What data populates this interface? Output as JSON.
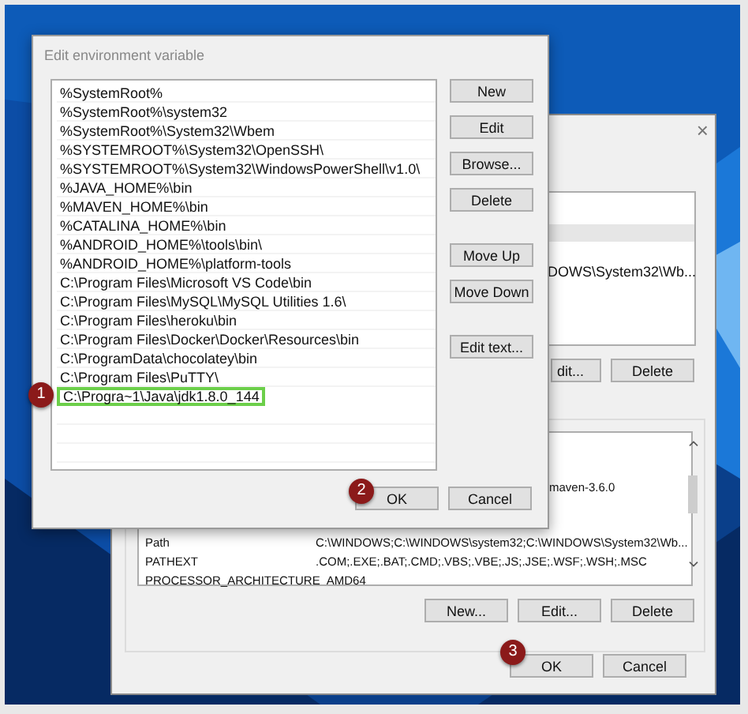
{
  "back_window": {
    "close": "×",
    "user_variables": [
      {
        "selected": true
      },
      {
        "value": "DOWS\\System32\\Wb...",
        "selected": false
      }
    ],
    "user_buttons": [
      "dit...",
      "Delete"
    ],
    "system_variables": [
      {
        "value": "maven-3.6.0",
        "selected": false
      },
      {
        "name": "Path",
        "value": "C:\\WINDOWS;C:\\WINDOWS\\system32;C:\\WINDOWS\\System32\\Wb...",
        "selected": false
      },
      {
        "name": "PATHEXT",
        "value": ".COM;.EXE;.BAT;.CMD;.VBS;.VBE;.JS;.JSE;.WSF;.WSH;.MSC",
        "selected": false
      },
      {
        "name": "PROCESSOR_ARCHITECTURE",
        "value": "AMD64",
        "selected": false
      }
    ],
    "system_buttons": [
      "New...",
      "Edit...",
      "Delete"
    ],
    "ok": "OK",
    "cancel": "Cancel"
  },
  "edit_dialog": {
    "title": "Edit environment variable",
    "paths": [
      {
        "text": "%SystemRoot%",
        "selected": false
      },
      {
        "text": "%SystemRoot%\\system32",
        "selected": false
      },
      {
        "text": "%SystemRoot%\\System32\\Wbem",
        "selected": false
      },
      {
        "text": "%SYSTEMROOT%\\System32\\OpenSSH\\",
        "selected": false
      },
      {
        "text": "%SYSTEMROOT%\\System32\\WindowsPowerShell\\v1.0\\",
        "selected": false
      },
      {
        "text": "%JAVA_HOME%\\bin",
        "selected": false
      },
      {
        "text": "%MAVEN_HOME%\\bin",
        "selected": false
      },
      {
        "text": "%CATALINA_HOME%\\bin",
        "selected": false
      },
      {
        "text": "%ANDROID_HOME%\\tools\\bin\\",
        "selected": false
      },
      {
        "text": "%ANDROID_HOME%\\platform-tools",
        "selected": false
      },
      {
        "text": "C:\\Program Files\\Microsoft VS Code\\bin",
        "selected": false
      },
      {
        "text": "C:\\Program Files\\MySQL\\MySQL Utilities 1.6\\",
        "selected": false
      },
      {
        "text": "C:\\Program Files\\heroku\\bin",
        "selected": false
      },
      {
        "text": "C:\\Program Files\\Docker\\Docker\\Resources\\bin",
        "selected": false
      },
      {
        "text": "C:\\ProgramData\\chocolatey\\bin",
        "selected": false
      },
      {
        "text": "C:\\Program Files\\PuTTY\\",
        "selected": false
      },
      {
        "text": "C:\\Progra~1\\Java\\jdk1.8.0_144",
        "selected": true
      }
    ],
    "side_buttons": [
      {
        "label": "New"
      },
      {
        "label": "Edit"
      },
      {
        "label": "Browse..."
      },
      {
        "label": "Delete"
      },
      {
        "label": "Move Up",
        "gap": true
      },
      {
        "label": "Move Down"
      },
      {
        "label": "Edit text...",
        "gap": true
      }
    ],
    "ok": "OK",
    "cancel": "Cancel"
  },
  "callouts": [
    "1",
    "2",
    "3"
  ]
}
